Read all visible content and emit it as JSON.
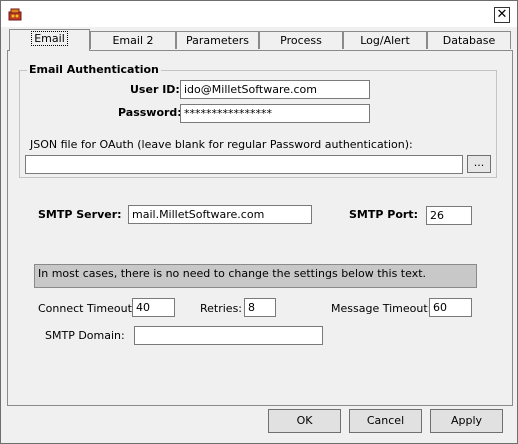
{
  "window": {
    "close_glyph": "✕"
  },
  "tabs": [
    {
      "label": "Email",
      "active": true
    },
    {
      "label": "Email 2",
      "active": false
    },
    {
      "label": "Parameters",
      "active": false
    },
    {
      "label": "Process",
      "active": false
    },
    {
      "label": "Log/Alert",
      "active": false
    },
    {
      "label": "Database",
      "active": false
    }
  ],
  "auth": {
    "group_title": "Email Authentication",
    "user_id_label": "User ID:",
    "user_id_value": "ido@MilletSoftware.com",
    "password_label": "Password:",
    "password_value": "****************",
    "json_label": "JSON file for OAuth (leave blank for regular Password authentication):",
    "json_value": "",
    "browse_label": "..."
  },
  "smtp": {
    "server_label": "SMTP Server:",
    "server_value": "mail.MilletSoftware.com",
    "port_label": "SMTP Port:",
    "port_value": "26"
  },
  "notice": "In most cases, there is no need to change the settings below this text.",
  "advanced": {
    "connect_timeout_label": "Connect Timeout:",
    "connect_timeout_value": "40",
    "retries_label": "Retries:",
    "retries_value": "8",
    "message_timeout_label": "Message Timeout:",
    "message_timeout_value": "60",
    "smtp_domain_label": "SMTP Domain:",
    "smtp_domain_value": ""
  },
  "buttons": {
    "ok": "OK",
    "cancel": "Cancel",
    "apply": "Apply"
  },
  "icons": {
    "app": "app-icon",
    "close": "close-icon",
    "browse": "browse-icon"
  },
  "colors": {
    "notice_bg": "#c8c8c8",
    "window_bg": "#f0f0f0"
  }
}
